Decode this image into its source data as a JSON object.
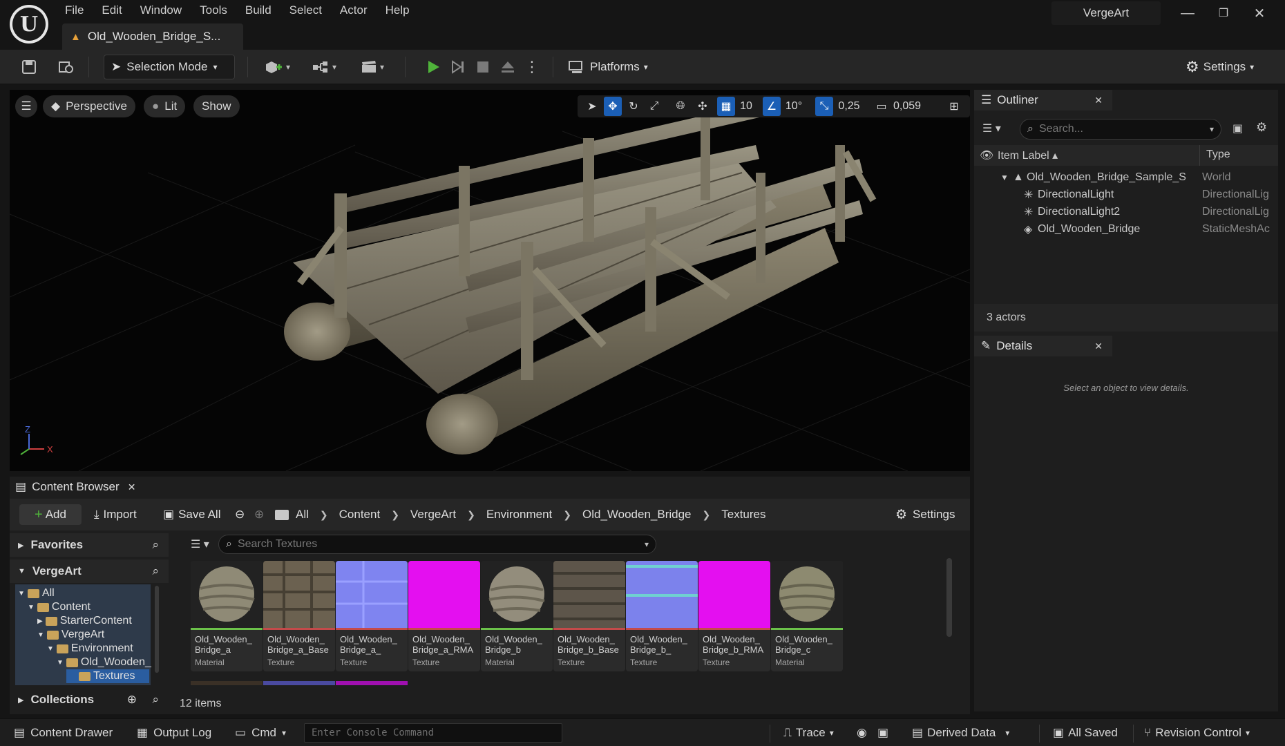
{
  "app": {
    "logo_text": "U",
    "project_name": "VergeArt",
    "level_tab": "Old_Wooden_Bridge_S...",
    "menu": [
      "File",
      "Edit",
      "Window",
      "Tools",
      "Build",
      "Select",
      "Actor",
      "Help"
    ]
  },
  "toolbar": {
    "selection_mode": "Selection Mode",
    "platforms": "Platforms",
    "settings": "Settings"
  },
  "viewport": {
    "perspective": "Perspective",
    "lit": "Lit",
    "show": "Show",
    "grid_snap": "10",
    "rotation_snap": "10°",
    "scale_snap": "0,25",
    "camera_speed": "0,059",
    "axis_x": "X",
    "axis_z": "Z"
  },
  "outliner": {
    "title": "Outliner",
    "search_placeholder": "Search...",
    "col_label": "Item Label",
    "col_type": "Type",
    "rows": [
      {
        "label": "Old_Wooden_Bridge_Sample_S",
        "type": "World"
      },
      {
        "label": "DirectionalLight",
        "type": "DirectionalLig"
      },
      {
        "label": "DirectionalLight2",
        "type": "DirectionalLig"
      },
      {
        "label": "Old_Wooden_Bridge",
        "type": "StaticMeshAc"
      }
    ],
    "actors_count": "3 actors"
  },
  "details": {
    "title": "Details",
    "hint": "Select an object to view details."
  },
  "content_browser": {
    "title": "Content Browser",
    "add": "Add",
    "import": "Import",
    "save_all": "Save All",
    "settings": "Settings",
    "breadcrumb": [
      "All",
      "Content",
      "VergeArt",
      "Environment",
      "Old_Wooden_Bridge",
      "Textures"
    ],
    "favorites": "Favorites",
    "project": "VergeArt",
    "collections": "Collections",
    "tree": [
      "All",
      "Content",
      "StarterContent",
      "VergeArt",
      "Environment",
      "Old_Wooden_",
      "Textures"
    ],
    "search_placeholder": "Search Textures",
    "items_count": "12 items",
    "assets": [
      {
        "name": "Old_Wooden_ Bridge_a",
        "kind": "Material"
      },
      {
        "name": "Old_Wooden_ Bridge_a_Base Color",
        "kind": "Texture"
      },
      {
        "name": "Old_Wooden_ Bridge_a_ Normal_DX",
        "kind": "Texture"
      },
      {
        "name": "Old_Wooden_ Bridge_a_RMA",
        "kind": "Texture"
      },
      {
        "name": "Old_Wooden_ Bridge_b",
        "kind": "Material"
      },
      {
        "name": "Old_Wooden_ Bridge_b_Base Color",
        "kind": "Texture"
      },
      {
        "name": "Old_Wooden_ Bridge_b_ Normal_DX",
        "kind": "Texture"
      },
      {
        "name": "Old_Wooden_ Bridge_b_RMA",
        "kind": "Texture"
      },
      {
        "name": "Old_Wooden_ Bridge_c",
        "kind": "Material"
      }
    ]
  },
  "statusbar": {
    "content_drawer": "Content Drawer",
    "output_log": "Output Log",
    "cmd": "Cmd",
    "console_placeholder": "Enter Console Command",
    "trace": "Trace",
    "derived_data": "Derived Data",
    "all_saved": "All Saved",
    "revision_control": "Revision Control"
  },
  "colors": {
    "accent_blue": "#1b5fb6",
    "play_green": "#4fb33a",
    "material_bar": "#6cc24a",
    "texture_bar": "#c44a4a",
    "folder": "#c9a35a"
  }
}
